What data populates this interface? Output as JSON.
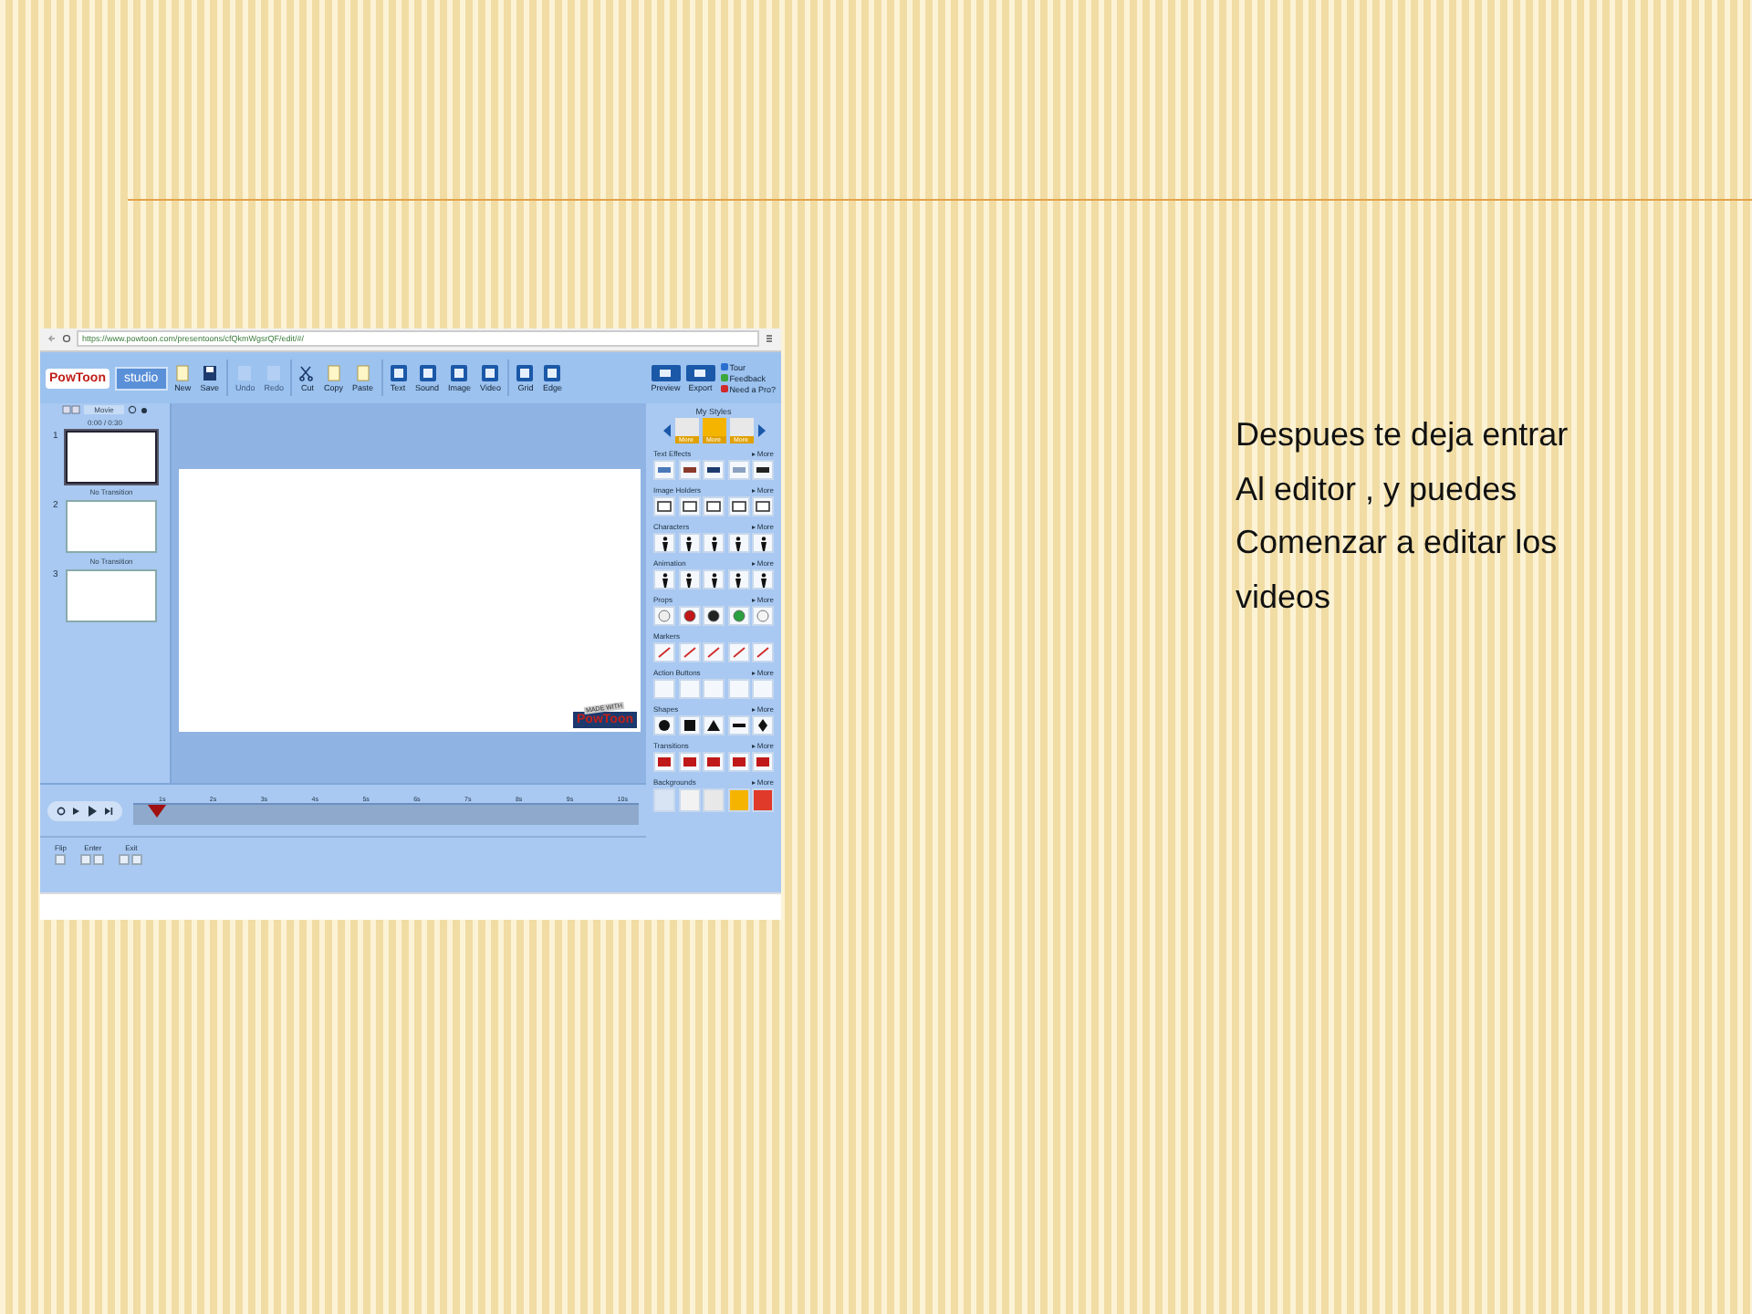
{
  "slide": {
    "text_lines": [
      "Despues te deja entrar",
      "Al editor , y puedes",
      "Comenzar a editar los",
      "videos"
    ]
  },
  "browser": {
    "url": "https://www.powtoon.com/presentoons/cfQkmWgsrQF/edit/#/"
  },
  "toolbar": {
    "logo": "PowToon",
    "logo_badge": "studio",
    "buttons": [
      {
        "label": "New",
        "kind": "page",
        "disabled": false
      },
      {
        "label": "Save",
        "kind": "disk",
        "disabled": false
      },
      {
        "label": "Undo",
        "kind": "blank",
        "disabled": true
      },
      {
        "label": "Redo",
        "kind": "blank",
        "disabled": true
      },
      {
        "label": "Cut",
        "kind": "scissors",
        "disabled": false
      },
      {
        "label": "Copy",
        "kind": "page",
        "disabled": false
      },
      {
        "label": "Paste",
        "kind": "page",
        "disabled": false
      },
      {
        "label": "Text",
        "kind": "tool",
        "disabled": false
      },
      {
        "label": "Sound",
        "kind": "tool",
        "disabled": false
      },
      {
        "label": "Image",
        "kind": "tool",
        "disabled": false
      },
      {
        "label": "Video",
        "kind": "tool",
        "disabled": false
      },
      {
        "label": "Grid",
        "kind": "tool",
        "disabled": false
      },
      {
        "label": "Edge",
        "kind": "tool",
        "disabled": false
      }
    ],
    "actions": [
      {
        "label": "Preview"
      },
      {
        "label": "Export"
      }
    ],
    "help_links": [
      {
        "label": "Tour",
        "color": "#2a6fd0"
      },
      {
        "label": "Feedback",
        "color": "#3aa83a"
      },
      {
        "label": "Need a Pro?",
        "color": "#d02a2a"
      }
    ]
  },
  "slides_panel": {
    "movie_field": "Movie",
    "time": "0:00 / 0:30",
    "slides": [
      {
        "number": "1",
        "selected": true,
        "transition": "No Transition"
      },
      {
        "number": "2",
        "selected": false,
        "transition": "No Transition"
      },
      {
        "number": "3",
        "selected": false
      }
    ]
  },
  "canvas": {
    "logo_tag": "MADE WITH",
    "logo": "PowToon"
  },
  "styles_panel": {
    "title": "My Styles",
    "styles": [
      {
        "label": "More",
        "selected": false
      },
      {
        "label": "More",
        "selected": true
      },
      {
        "label": "More",
        "selected": false
      }
    ],
    "categories": [
      {
        "title": "Text Effects",
        "more": "▸ More",
        "kind": "text"
      },
      {
        "title": "Image Holders",
        "more": "▸ More",
        "kind": "frame"
      },
      {
        "title": "Characters",
        "more": "▸ More",
        "kind": "person"
      },
      {
        "title": "Animation",
        "more": "▸ More",
        "kind": "person"
      },
      {
        "title": "Props",
        "more": "▸ More",
        "kind": "prop"
      },
      {
        "title": "Markers",
        "kind": "marker"
      },
      {
        "title": "Action Buttons",
        "more": "▸ More",
        "kind": "empty"
      },
      {
        "title": "Shapes",
        "more": "▸ More",
        "kind": "shape"
      },
      {
        "title": "Transitions",
        "more": "▸ More",
        "kind": "transition"
      },
      {
        "title": "Backgrounds",
        "more": "▸ More",
        "kind": "swatch",
        "swatches": [
          {
            "color": "#d8e4f4"
          },
          {
            "color": "#f2f2f2"
          },
          {
            "color": "#e8e8e8"
          },
          {
            "color": "#f5b400"
          },
          {
            "color": "#e03a2a"
          }
        ]
      }
    ]
  },
  "timeline": {
    "ticks": [
      "1s",
      "2s",
      "3s",
      "4s",
      "5s",
      "6s",
      "7s",
      "8s",
      "9s",
      "10s"
    ],
    "level": 0.03,
    "controls": [
      {
        "label": "Flip",
        "kind": "flip"
      },
      {
        "label": "Enter",
        "kind": "pair"
      },
      {
        "label": "Exit",
        "kind": "pair"
      }
    ]
  }
}
